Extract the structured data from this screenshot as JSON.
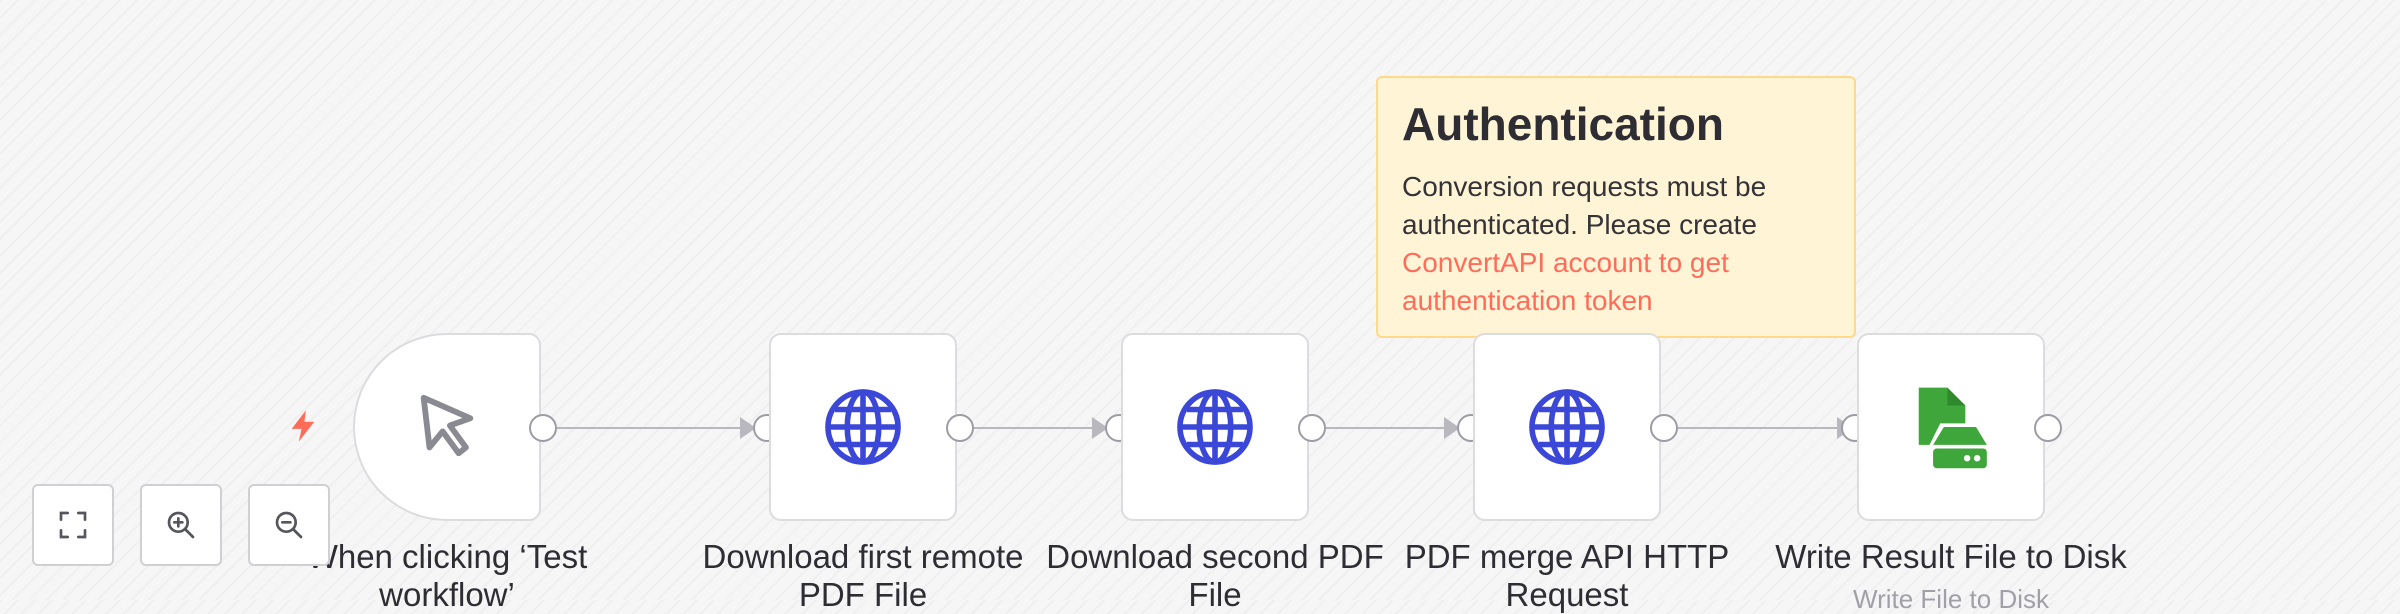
{
  "colors": {
    "accent": "#ff6d5a",
    "http_icon": "#3b47d6",
    "file_icon": "#3fa63b",
    "sticky_bg": "#fff5d6"
  },
  "nodes": [
    {
      "label": "When clicking ‘Test workflow’",
      "icon": "cursor-icon"
    },
    {
      "label": "Download first remote PDF File",
      "icon": "globe-icon"
    },
    {
      "label": "Download second PDF File",
      "icon": "globe-icon"
    },
    {
      "label": "PDF merge API HTTP Request",
      "icon": "globe-icon"
    },
    {
      "label": "Write Result File to Disk",
      "subtitle": "Write File to Disk",
      "icon": "file-disk-icon"
    }
  ],
  "sticky_note": {
    "title": "Authentication",
    "body": "Conversion requests must be authenticated. Please create ",
    "link_text": "ConvertAPI account to get authentication token"
  },
  "canvas_controls": [
    {
      "name": "fit-view",
      "icon": "fullscreen-icon"
    },
    {
      "name": "zoom-in",
      "icon": "zoom-in-icon"
    },
    {
      "name": "zoom-out",
      "icon": "zoom-out-icon"
    }
  ]
}
